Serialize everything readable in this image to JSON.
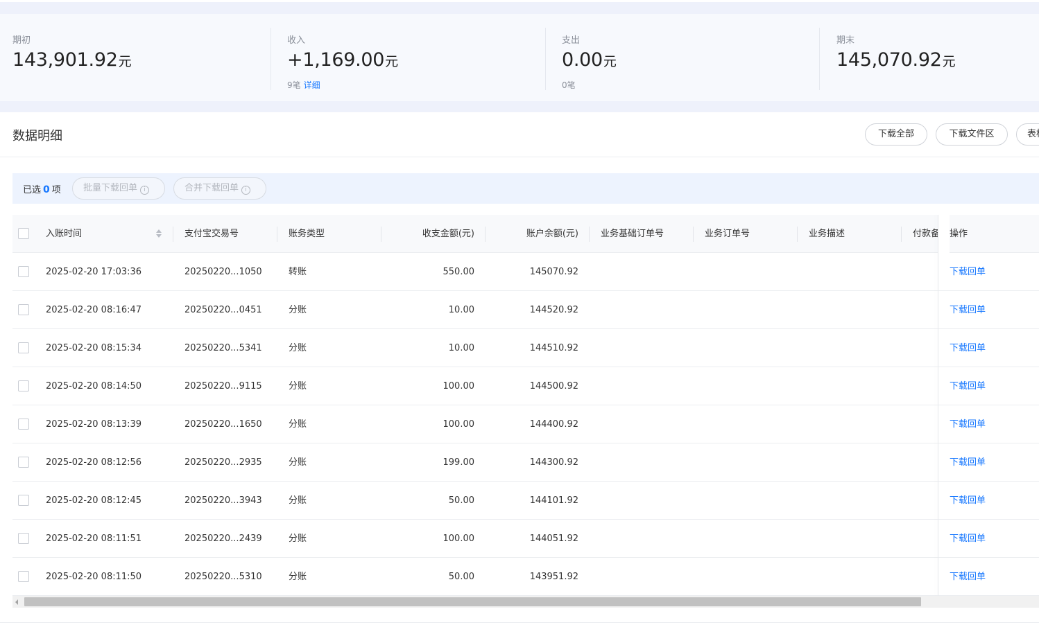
{
  "summary": {
    "opening": {
      "label": "期初",
      "amount": "143,901.92",
      "unit": "元"
    },
    "income": {
      "label": "收入",
      "amount": "+1,169.00",
      "unit": "元",
      "count": "9笔",
      "detail_link": "详细"
    },
    "expense": {
      "label": "支出",
      "amount": "0.00",
      "unit": "元",
      "count": "0笔"
    },
    "closing": {
      "label": "期末",
      "amount": "145,070.92",
      "unit": "元"
    }
  },
  "detail": {
    "title": "数据明细",
    "buttons": {
      "download_all": "下载全部",
      "download_files": "下载文件区",
      "more": "表格"
    }
  },
  "selection": {
    "prefix": "已选",
    "count": "0",
    "suffix": "项",
    "batch_download": "批量下载回单",
    "merge_download": "合并下载回单"
  },
  "table": {
    "columns": {
      "time": "入账时间",
      "trade_no": "支付宝交易号",
      "type": "账务类型",
      "amount": "收支金额(元)",
      "balance": "账户余额(元)",
      "base_order": "业务基础订单号",
      "order": "业务订单号",
      "desc": "业务描述",
      "remark": "付款备注",
      "action": "操作"
    },
    "rows": [
      {
        "time": "2025-02-20 17:03:36",
        "trade_no": "20250220...1050",
        "type": "转账",
        "amount": "550.00",
        "balance": "145070.92",
        "action": "下载回单"
      },
      {
        "time": "2025-02-20 08:16:47",
        "trade_no": "20250220...0451",
        "type": "分账",
        "amount": "10.00",
        "balance": "144520.92",
        "action": "下载回单"
      },
      {
        "time": "2025-02-20 08:15:34",
        "trade_no": "20250220...5341",
        "type": "分账",
        "amount": "10.00",
        "balance": "144510.92",
        "action": "下载回单"
      },
      {
        "time": "2025-02-20 08:14:50",
        "trade_no": "20250220...9115",
        "type": "分账",
        "amount": "100.00",
        "balance": "144500.92",
        "action": "下载回单"
      },
      {
        "time": "2025-02-20 08:13:39",
        "trade_no": "20250220...1650",
        "type": "分账",
        "amount": "100.00",
        "balance": "144400.92",
        "action": "下载回单"
      },
      {
        "time": "2025-02-20 08:12:56",
        "trade_no": "20250220...2935",
        "type": "分账",
        "amount": "199.00",
        "balance": "144300.92",
        "action": "下载回单"
      },
      {
        "time": "2025-02-20 08:12:45",
        "trade_no": "20250220...3943",
        "type": "分账",
        "amount": "50.00",
        "balance": "144101.92",
        "action": "下载回单"
      },
      {
        "time": "2025-02-20 08:11:51",
        "trade_no": "20250220...2439",
        "type": "分账",
        "amount": "100.00",
        "balance": "144051.92",
        "action": "下载回单"
      },
      {
        "time": "2025-02-20 08:11:50",
        "trade_no": "20250220...5310",
        "type": "分账",
        "amount": "50.00",
        "balance": "143951.92",
        "action": "下载回单"
      }
    ]
  },
  "colors": {
    "accent": "#1677ff",
    "summary_bg": "#f7f9fd",
    "select_bar_bg": "#edf3fe"
  }
}
